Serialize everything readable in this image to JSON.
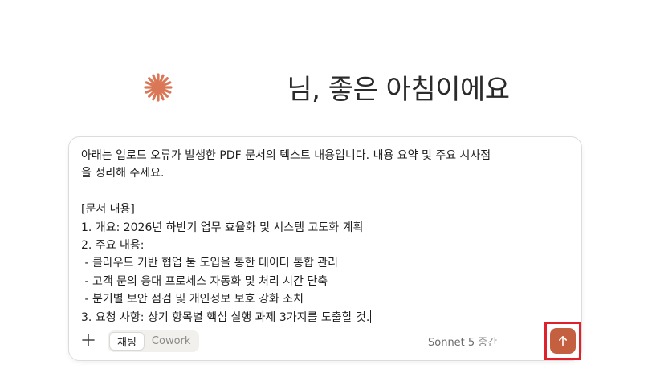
{
  "greeting": {
    "text": "님, 좋은 아침이에요"
  },
  "composer": {
    "prompt_lines": [
      "아래는 업로드 오류가 발생한 PDF 문서의 텍스트 내용입니다. 내용 요약 및 주요 시사점",
      "을 정리해 주세요.",
      "",
      "[문서 내용]",
      "1. 개요: 2026년 하반기 업무 효율화 및 시스템 고도화 계획",
      "2. 주요 내용:",
      " - 클라우드 기반 협업 툴 도입을 통한 데이터 통합 관리",
      " - 고객 문의 응대 프로세스 자동화 및 처리 시간 단축",
      " - 분기별 보안 점검 및 개인정보 보호 강화 조치",
      "3. 요청 사항: 상기 항목별 핵심 실행 과제 3가지를 도출할 것."
    ],
    "add_icon": "plus-icon",
    "modes": [
      {
        "label": "채팅",
        "active": true
      },
      {
        "label": "Cowork",
        "active": false
      }
    ],
    "model": {
      "name": "Sonnet 5",
      "effort": "중간"
    },
    "send_icon": "arrow-up-icon"
  },
  "colors": {
    "accent": "#c4603f",
    "logo": "#d97757",
    "highlight_box": "#e0202a"
  }
}
